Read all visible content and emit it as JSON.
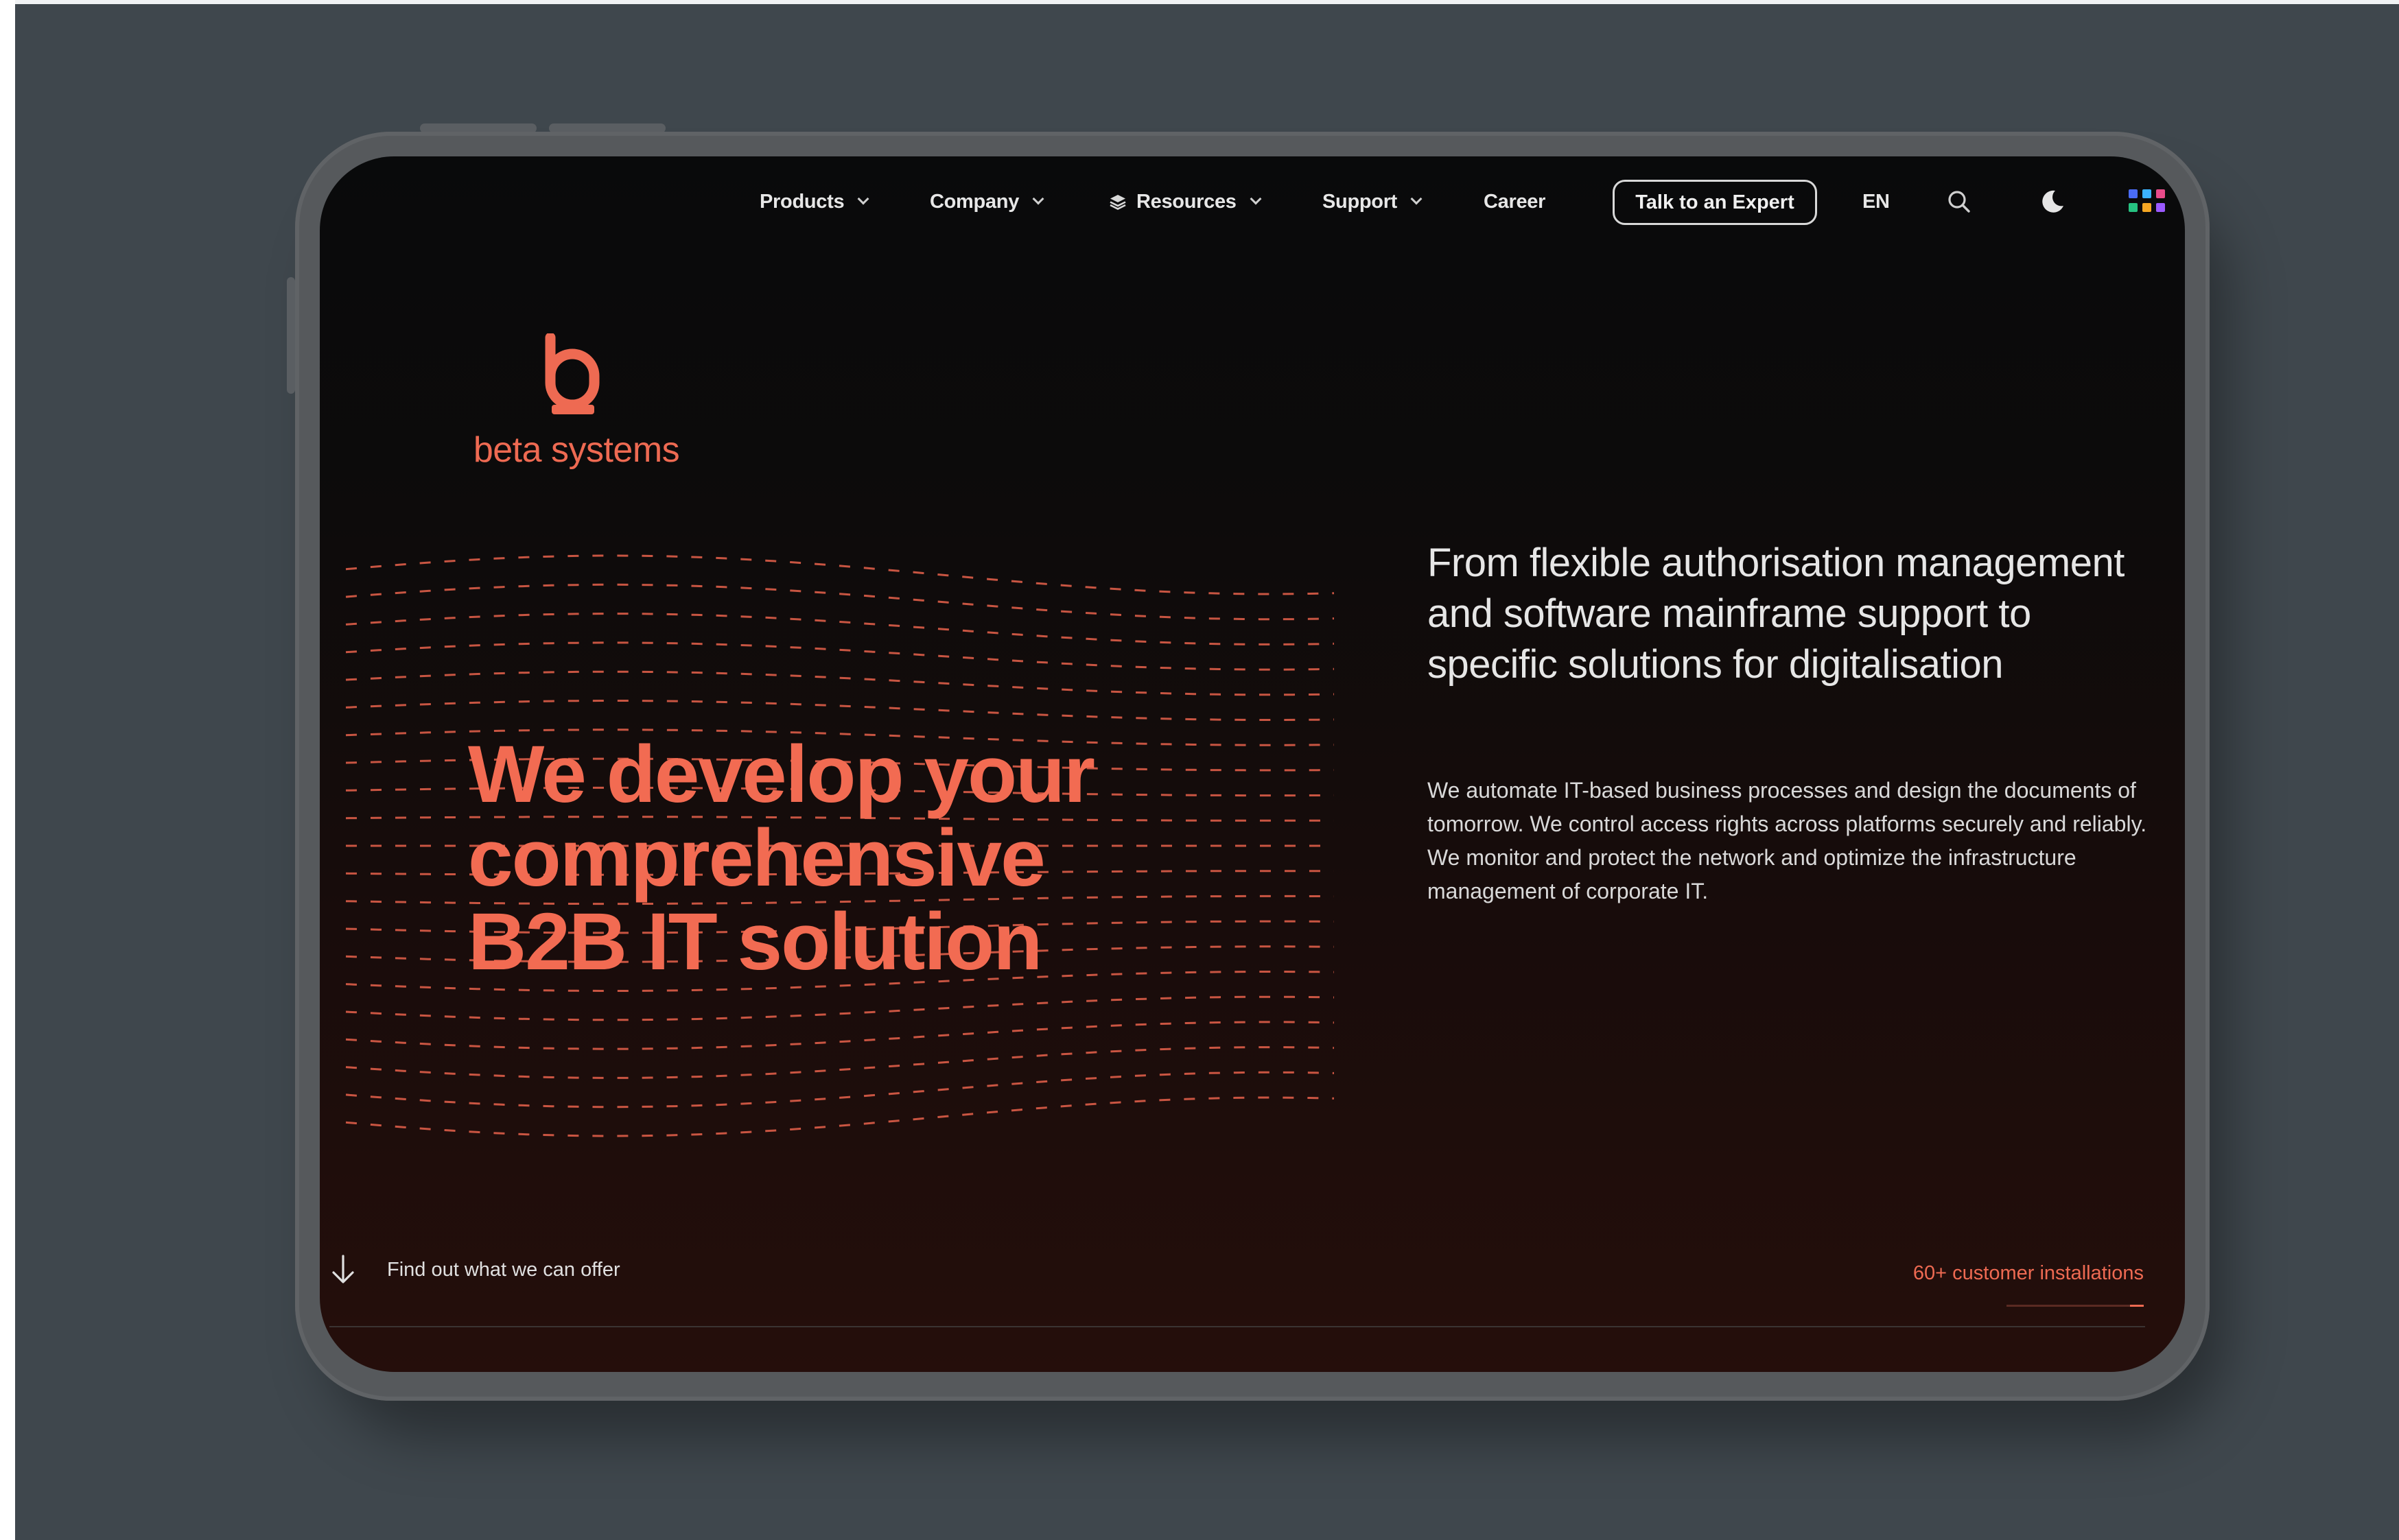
{
  "nav": {
    "items": [
      {
        "label": "Products",
        "dropdown": true
      },
      {
        "label": "Company",
        "dropdown": true
      },
      {
        "label": "Resources",
        "dropdown": true,
        "icon": "layers-icon"
      },
      {
        "label": "Support",
        "dropdown": true
      },
      {
        "label": "Career",
        "dropdown": false
      }
    ],
    "cta_label": "Talk to an Expert",
    "language": "EN",
    "icons": [
      "search-icon",
      "moon-icon",
      "apps-grid-icon"
    ]
  },
  "brand": {
    "name": "beta systems",
    "color": "#ee6a52"
  },
  "hero": {
    "headline_lines": [
      "We develop your",
      "comprehensive",
      "B2B IT solution"
    ],
    "lead": "From flexible authorisation management and software mainframe support to specific solutions for digitalisation",
    "body": "We automate IT-based business processes and design the documents of tomorrow. We control access rights across platforms securely and reliably. We monitor and protect the network and optimize the infrastructure management of corporate IT.",
    "scroll_cta": "Find out what we can offer",
    "stat_label": "60+ customer installations",
    "stat_progress": 0.1
  },
  "colors": {
    "accent": "#f26b52",
    "background": "#0a0a0b",
    "frame": "#3f474d"
  }
}
